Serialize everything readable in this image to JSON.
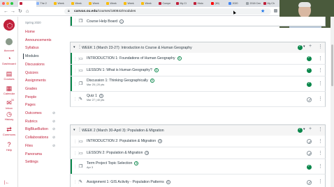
{
  "browser": {
    "tabs": [
      {
        "label": "",
        "color": "#c0203a"
      },
      {
        "label": "The 2",
        "color": "#8ab4f8"
      },
      {
        "label": "Week",
        "color": "#fbbc04"
      },
      {
        "label": "Week",
        "color": "#fbbc04"
      },
      {
        "label": "Week",
        "color": "#fbbc04"
      },
      {
        "label": "Week",
        "color": "#fbbc04"
      },
      {
        "label": "Week",
        "color": "#fbbc04"
      },
      {
        "label": "Week",
        "color": "#fbbc04"
      },
      {
        "label": "Compe",
        "color": "#c0203a"
      },
      {
        "label": "My Cl",
        "color": "#c0203a"
      },
      {
        "label": "Histo",
        "color": "#c0203a"
      },
      {
        "label": "(80)",
        "color": "#ff0000"
      },
      {
        "label": "2020",
        "color": "#4285f4"
      },
      {
        "label": "2018 Cen",
        "color": "#9aa0a6"
      },
      {
        "label": "My Ch",
        "color": "#c0203a"
      }
    ],
    "url_host": "canvas.ou.edu",
    "url_path": "/courses/180842/modules",
    "url_prefix": ""
  },
  "video": {
    "participant_name": "Randy Peppler"
  },
  "global_nav": {
    "items": [
      {
        "label": "Account",
        "icon": "account-icon",
        "glyph": ""
      },
      {
        "label": "Dashboard",
        "icon": "dashboard-icon",
        "glyph": "◔"
      },
      {
        "label": "Courses",
        "icon": "courses-icon",
        "glyph": "▤"
      },
      {
        "label": "Calendar",
        "icon": "calendar-icon",
        "glyph": "▦"
      },
      {
        "label": "Inbox",
        "icon": "inbox-icon",
        "glyph": "✉"
      },
      {
        "label": "History",
        "icon": "history-icon",
        "glyph": "◷"
      },
      {
        "label": "Commons",
        "icon": "commons-icon",
        "glyph": "⇄"
      },
      {
        "label": "Help",
        "icon": "help-icon",
        "glyph": "?"
      }
    ],
    "inbox_badge": "34",
    "collapse_glyph": "|←"
  },
  "course_nav": {
    "term": "Spring 2020",
    "items": [
      "Home",
      "Announcements",
      "Syllabus",
      "Modules",
      "Discussions",
      "Quizzes",
      "Assignments",
      "Grades",
      "People",
      "Pages",
      "Outcomes",
      "Rubrics",
      "BigBlueButton",
      "Collaborations",
      "Files",
      "Panorama",
      "Settings"
    ],
    "active": "Modules"
  },
  "modules": {
    "top_item": {
      "title": "Course Help Board"
    },
    "week1": {
      "title": "WEEK 1 (March 23-27): Introduction to Course & Human Geography",
      "items": [
        {
          "title": "INTRODUCTION 1: Foundations of Human Geography",
          "meta": "",
          "icon": "page-icon",
          "glyph": "▭",
          "published": true
        },
        {
          "title": "LESSON 1: What is Human Geography?",
          "meta": "",
          "icon": "page-icon",
          "glyph": "▭",
          "published": true
        },
        {
          "title": "Discussion 1: Thinking Geographically",
          "meta": "Mar 25  |  20 pts",
          "icon": "discussion-icon",
          "glyph": "❐",
          "published": true
        },
        {
          "title": "Quiz 1",
          "meta": "Mar 27  |  40 pts",
          "icon": "quiz-icon",
          "glyph": "✎",
          "published": false
        }
      ]
    },
    "week2": {
      "title": "WEEK 2 (March 30-April 3): Population & Migration",
      "items": [
        {
          "title": "INTRODUCTION 2: Population & Migration",
          "meta": "",
          "icon": "page-icon",
          "glyph": "▭",
          "published": false
        },
        {
          "title": "LESSON 2: Population & Migration",
          "meta": "",
          "icon": "page-icon",
          "glyph": "▭",
          "published": false
        },
        {
          "title": "Term Project Topic Selection",
          "meta": "Apr 3",
          "icon": "discussion-icon",
          "glyph": "❐",
          "published": true
        },
        {
          "title": "Assignment 1: GIS Activity - Population Patterns",
          "meta": "",
          "icon": "assignment-icon",
          "glyph": "✎",
          "published": false
        }
      ]
    }
  },
  "colors": {
    "brand": "#c0203a",
    "published": "#0b874b",
    "text": "#2d3b45"
  }
}
